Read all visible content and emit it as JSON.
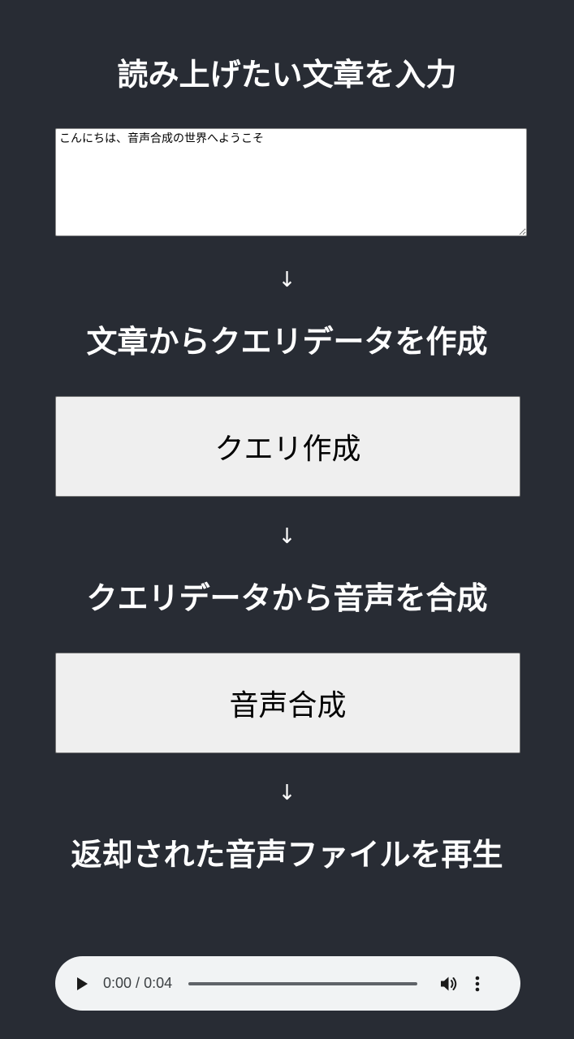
{
  "section1": {
    "heading": "読み上げたい文章を入力"
  },
  "text_input": {
    "value": "こんにちは、音声合成の世界へようこそ"
  },
  "arrows": [
    "↓",
    "↓",
    "↓"
  ],
  "section2": {
    "heading": "文章からクエリデータを作成",
    "button_label": "クエリ作成"
  },
  "section3": {
    "heading": "クエリデータから音声を合成",
    "button_label": "音声合成"
  },
  "section4": {
    "heading": "返却された音声ファイルを再生"
  },
  "audio_player": {
    "current_time": "0:00",
    "separator": " / ",
    "duration": "0:04",
    "progress": 0,
    "play_icon": "play-icon",
    "volume_icon": "volume-icon",
    "menu_icon": "more-vert-icon"
  },
  "colors": {
    "background": "#282c34",
    "heading_text": "#ffffff",
    "button_bg": "#efefef",
    "player_bg": "#f1f3f4"
  }
}
